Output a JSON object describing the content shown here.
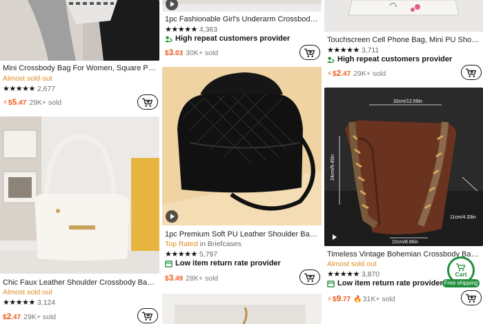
{
  "products": {
    "p1": {
      "title": "Mini Crossbody Bag For Women, Square Purs...",
      "status": "Almost sold out",
      "stars": "★★★★★",
      "reviews": "2,677",
      "price_symbol": "$",
      "price_main": "5",
      "price_cents": ".47",
      "sold": "29K+ sold"
    },
    "p2": {
      "title": "Chic Faux Leather Shoulder Crossbody Bag -...",
      "status": "Almost sold out",
      "stars": "★★★★★",
      "reviews": "3,124",
      "price_symbol": "$",
      "price_main": "2",
      "price_cents": ".47",
      "sold": "29K+ sold"
    },
    "p3": {
      "title": "1pc Fashionable Girl's Underarm Crossbody...",
      "stars": "★★★★★",
      "reviews": "4,363",
      "feature": "High repeat customers provider",
      "price_symbol": "$",
      "price_main": "3",
      "price_cents": ".03",
      "sold": "30K+ sold"
    },
    "p4": {
      "title": "1pc Premium Soft PU Leather Shoulder Bag -...",
      "top_rated": "Top Rated",
      "top_rated_in": "in Briefcases",
      "stars": "★★★★★",
      "reviews": "5,797",
      "feature": "Low item return rate provider",
      "price_symbol": "$",
      "price_main": "3",
      "price_cents": ".49",
      "sold": "28K+ sold"
    },
    "p5": {
      "title": "Touchscreen Cell Phone Bag, Mini PU Should...",
      "stars": "★★★★★",
      "reviews": "3,711",
      "feature": "High repeat customers provider",
      "price_symbol": "$",
      "price_main": "2",
      "price_cents": ".47",
      "sold": "29K+ sold"
    },
    "p6": {
      "title": "Timeless Vintage Bohemian Crossbody Bag...",
      "status": "Almost sold out",
      "stars": "★★★★★",
      "reviews": "3,870",
      "feature": "Low item return rate provider",
      "price_symbol": "$",
      "price_main": "9",
      "price_cents": ".77",
      "sold": "31K+ sold"
    }
  },
  "bag_dimensions": {
    "width": "32cm/12.59in",
    "height": "24cm/9.45in",
    "depth": "11cm/4.33in",
    "bottom": "22cm/8.66in"
  },
  "floating_cart": {
    "label": "Cart",
    "badge": "Free shipping"
  },
  "colors": {
    "price": "#f05a1a",
    "sold_out": "#e08a1e",
    "cart_green": "#1f8f3a"
  },
  "icons": {
    "cart": "cart-icon",
    "play": "play-icon",
    "lightning": "lightning-icon",
    "flame": "flame-icon",
    "repeat": "repeat-customers-icon",
    "return": "return-rate-icon"
  }
}
